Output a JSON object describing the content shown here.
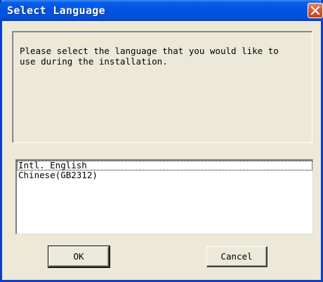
{
  "window": {
    "title": "Select Language"
  },
  "message": {
    "text": "Please select the language that you would like to\nuse during the installation."
  },
  "languages": [
    {
      "label": "Intl. English",
      "selected": true
    },
    {
      "label": "Chinese(GB2312)",
      "selected": false
    }
  ],
  "buttons": {
    "ok_label": "OK",
    "cancel_label": "Cancel"
  },
  "icons": {
    "close": "close-icon"
  },
  "colors": {
    "titlebar": "#0054e3",
    "close": "#d95b36",
    "face": "#ece9d8"
  }
}
